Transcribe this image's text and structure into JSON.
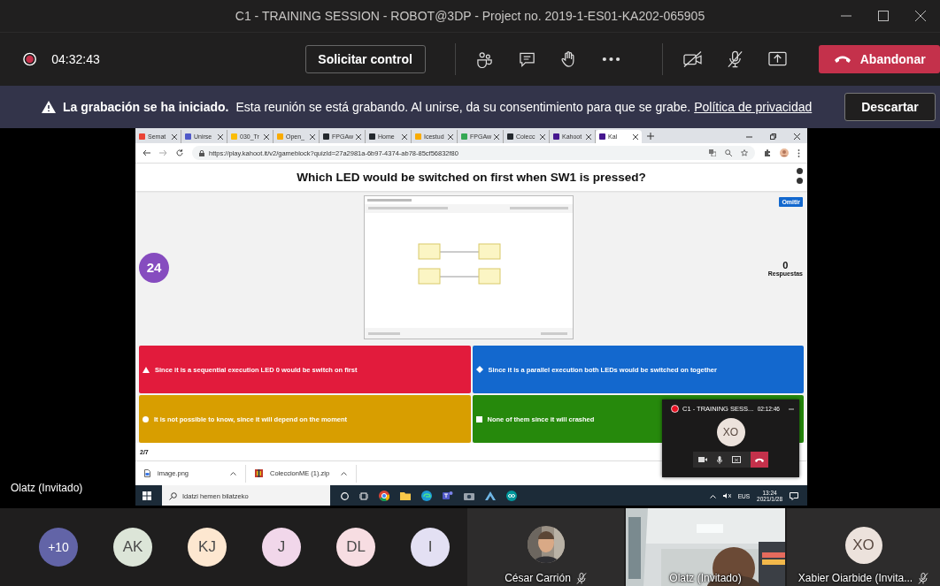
{
  "window": {
    "title": "C1 - TRAINING SESSION - ROBOT@3DP - Project no. 2019-1-ES01-KA202-065905"
  },
  "call_bar": {
    "timer": "04:32:43",
    "request_control": "Solicitar control",
    "leave": "Abandonar"
  },
  "banner": {
    "title": "La grabación se ha iniciado.",
    "message": "Esta reunión se está grabando. Al unirse, da su consentimiento para que se grabe.",
    "link": "Política de privacidad",
    "dismiss": "Descartar"
  },
  "shared_screen": {
    "presenter": "Olatz (Invitado)",
    "browser": {
      "tabs": [
        {
          "label": "Semat",
          "color": "#ea4335",
          "selected": false
        },
        {
          "label": "Unirse",
          "color": "#5059c9",
          "selected": false
        },
        {
          "label": "030_Tr",
          "color": "#fbbc04",
          "selected": false
        },
        {
          "label": "Open_",
          "color": "#f9ab00",
          "selected": false
        },
        {
          "label": "FPGAw",
          "color": "#24292e",
          "selected": false
        },
        {
          "label": "Home",
          "color": "#24292e",
          "selected": false
        },
        {
          "label": "Icestud",
          "color": "#f9ab00",
          "selected": false
        },
        {
          "label": "FPGAw",
          "color": "#34a853",
          "selected": false
        },
        {
          "label": "Colecc",
          "color": "#24292e",
          "selected": false
        },
        {
          "label": "Kahoot",
          "color": "#46178f",
          "selected": false
        },
        {
          "label": "Kal",
          "color": "#46178f",
          "selected": true
        }
      ],
      "url": "https://play.kahoot.it/v2/gameblock?quizId=27a2981a-6b97-4374-ab78-85cf56832f80",
      "question": "Which LED would be switched on first when SW1 is pressed?",
      "timer": "24",
      "skip": "Omitir",
      "answer_count": "0",
      "answer_label": "Respuestas",
      "answers": [
        {
          "kind": "triangle",
          "color": "#e21b3c",
          "text": "Since it is a sequential execution LED 0 would be switch on first"
        },
        {
          "kind": "diamond",
          "color": "#1368ce",
          "text": "Since it is a parallel execution both LEDs would be switched on together"
        },
        {
          "kind": "circle",
          "color": "#d89e00",
          "text": "It is not possible to know, since it will depend on the moment"
        },
        {
          "kind": "square",
          "color": "#26890c",
          "text": "None of them since it will crashed"
        }
      ],
      "progress": "2/7"
    },
    "downloads": [
      {
        "name": "image.png"
      },
      {
        "kind": "zip",
        "name": "ColeccionME (1).zip"
      }
    ],
    "taskbar": {
      "search_placeholder": "Idatzi hemen bilatzeko",
      "language": "EUS",
      "time": "13:24",
      "date": "2021/1/28"
    }
  },
  "mini_window": {
    "title": "C1 - TRAINING SESS...",
    "timer": "02:12:46",
    "avatar": "XO"
  },
  "participants": [
    {
      "initials": "+10",
      "color": "#6264a7"
    },
    {
      "initials": "AK",
      "color": "#dce5d8"
    },
    {
      "initials": "KJ",
      "color": "#fde7d0"
    },
    {
      "initials": "J",
      "color": "#f1d7ea"
    },
    {
      "initials": "DL",
      "color": "#f7dde2"
    },
    {
      "initials": "I",
      "color": "#e3e0f3"
    }
  ],
  "tiles": [
    {
      "name": "César Carrión",
      "muted": true
    },
    {
      "kind": "video",
      "name": "Olatz (Invitado)",
      "muted": false
    },
    {
      "kind": "initials",
      "initials": "XO",
      "name": "Xabier Oiarbide (Invita...",
      "muted": true
    }
  ]
}
